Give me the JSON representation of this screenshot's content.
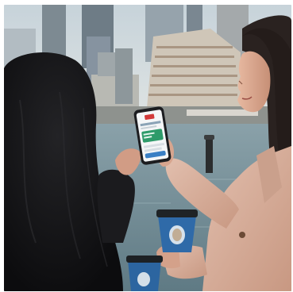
{
  "photo": {
    "scene": "two-women-viewing-smartphone-by-waterfront",
    "palette": {
      "sky": "#cdd8de",
      "water": "#6f8c96",
      "coat": "#d9b09c",
      "hair": "#141416",
      "cup_blue": "#2f6aa8"
    }
  },
  "phone_screen": {
    "icons": [
      "logo-icon",
      "rewards-card-icon"
    ]
  }
}
